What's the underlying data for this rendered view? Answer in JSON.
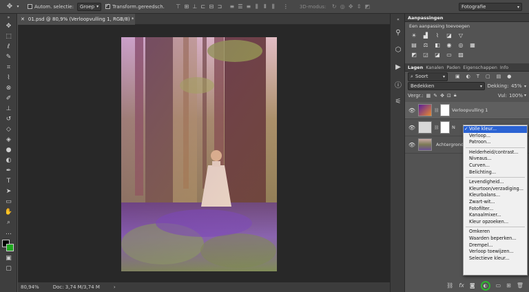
{
  "optbar": {
    "auto_select_label": "Autom. selectie:",
    "auto_select_value": "Groep",
    "transform_label": "Transform.gereedsch.",
    "mode_3d_label": "3D-modus:",
    "workspace": "Fotografie"
  },
  "document": {
    "tab_title": "01.psd @ 80,9% (Verloopvulling 1, RGB/8) *"
  },
  "status": {
    "zoom": "80,94%",
    "doc": "Doc: 3,74 M/3,74 M"
  },
  "adjustments": {
    "title": "Aanpassingen",
    "subtitle": "Een aanpassing toevoegen"
  },
  "layers_panel": {
    "tabs": [
      "Lagen",
      "Kanalen",
      "Paden",
      "Eigenschappen",
      "Info"
    ],
    "filter_label": "Soort",
    "blend_mode": "Bedekken",
    "opacity_label": "Dekking:",
    "opacity_value": "45%",
    "lock_label": "Vergr.:",
    "fill_label": "Vul:",
    "fill_value": "100%",
    "layers": [
      {
        "name": "Verloopvulling 1"
      },
      {
        "name": "N"
      },
      {
        "name": "Achtergrond"
      }
    ]
  },
  "menu": {
    "groups": [
      [
        "Volle kleur...",
        "Verloop...",
        "Patroon..."
      ],
      [
        "Helderheid/contrast...",
        "Niveaus...",
        "Curven...",
        "Belichting..."
      ],
      [
        "Levendigheid...",
        "Kleurtoon/verzadiging...",
        "Kleurbalans...",
        "Zwart-wit...",
        "Fotofilter...",
        "Kanaalmixer...",
        "Kleur opzoeken..."
      ],
      [
        "Omkeren",
        "Waarden beperken...",
        "Drempel...",
        "Verloop toewijzen...",
        "Selectieve kleur..."
      ]
    ],
    "selected_item": "Volle kleur..."
  },
  "colors": {
    "highlight": "#2b63d3",
    "callout_ring": "#2eb82e"
  }
}
